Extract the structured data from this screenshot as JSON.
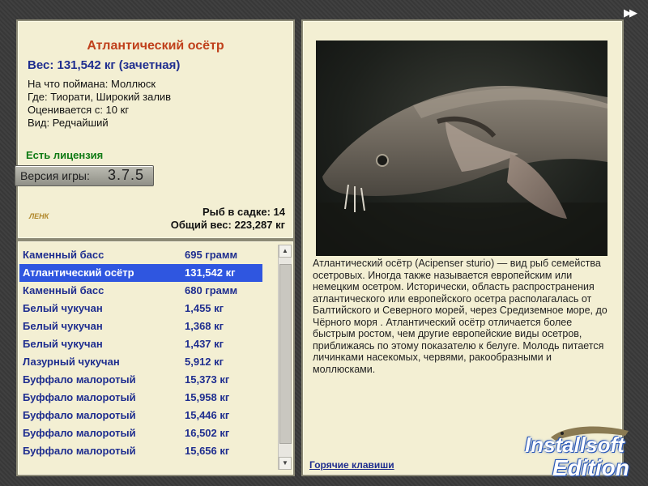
{
  "fish_info": {
    "title": "Атлантический осётр",
    "weight": "Вес: 131,542 кг (зачетная)",
    "caught_on": "На что поймана: Моллюск",
    "where": "Где: Тиорати, Широкий залив",
    "rated_from": "Оценивается с: 10 кг",
    "kind": "Вид: Редчайший",
    "license": "Есть лицензия",
    "version_label": "Версия игры:",
    "version_value": "3.7.5",
    "fish_in_keepnet": "Рыб в садке: 14",
    "total_weight": "Общий вес: 223,287 кг",
    "logo_text": "ЛЕНК"
  },
  "catch_list": [
    {
      "name": "Каменный басс",
      "weight": "695 грамм"
    },
    {
      "name": "Атлантический осётр",
      "weight": "131,542 кг",
      "selected": true
    },
    {
      "name": "Каменный басс",
      "weight": "680 грамм"
    },
    {
      "name": "Белый чукучан",
      "weight": "1,455 кг"
    },
    {
      "name": "Белый чукучан",
      "weight": "1,368 кг"
    },
    {
      "name": "Белый чукучан",
      "weight": "1,437 кг"
    },
    {
      "name": "Лазурный чукучан",
      "weight": "5,912 кг"
    },
    {
      "name": "Буффало малоротый",
      "weight": "15,373 кг"
    },
    {
      "name": "Буффало малоротый",
      "weight": "15,958 кг"
    },
    {
      "name": "Буффало малоротый",
      "weight": "15,446 кг"
    },
    {
      "name": "Буффало малоротый",
      "weight": "16,502 кг"
    },
    {
      "name": "Буффало малоротый",
      "weight": "15,656 кг"
    }
  ],
  "description": "Атлантический осётр (Acipenser sturio) — вид рыб семейства осетровых. Иногда также называется европейским или немецким осетром. Исторически, область распространения атлантического или европейского осетра располагалась от Балтийского и Северного морей, через Средиземное море, до Чёрного моря . Атлантический осётр отличается более быстрым ростом, чем другие европейские виды осетров, приближаясь по этому показателю к белуге. Молодь питается личинками насекомых, червями, ракообразными и моллюсками.",
  "hotkeys_link": "Горячие клавиши",
  "watermark": {
    "line1": "Installsoft",
    "line2": "Edition"
  },
  "colors": {
    "selection": "#2f56e0",
    "title": "#c0411c",
    "accent_blue": "#1f2e8f",
    "license_green": "#0f7a14"
  }
}
